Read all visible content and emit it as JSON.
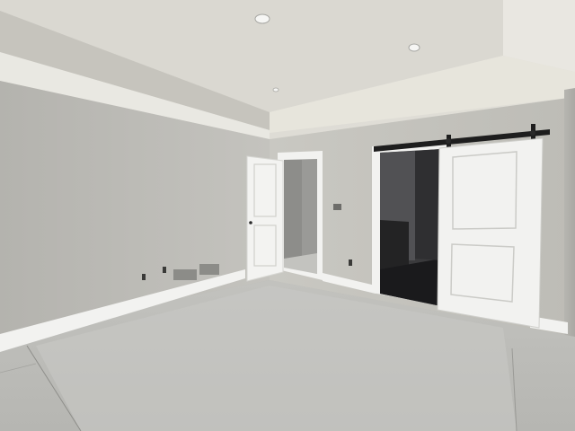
{
  "scene": {
    "subject": "empty-bedroom",
    "palette": {
      "ceiling": "#dcdad3",
      "ceiling_recess": "#e6e4de",
      "left_wall": "#bdbcb7",
      "back_wall": "#c7c6c0",
      "trim": "#f4f4f2",
      "door": "#f1f1ef",
      "floor": "#bcbcb8",
      "barn_rail": "#1e1e1e",
      "closet_interior": "#2c2c2e"
    }
  }
}
